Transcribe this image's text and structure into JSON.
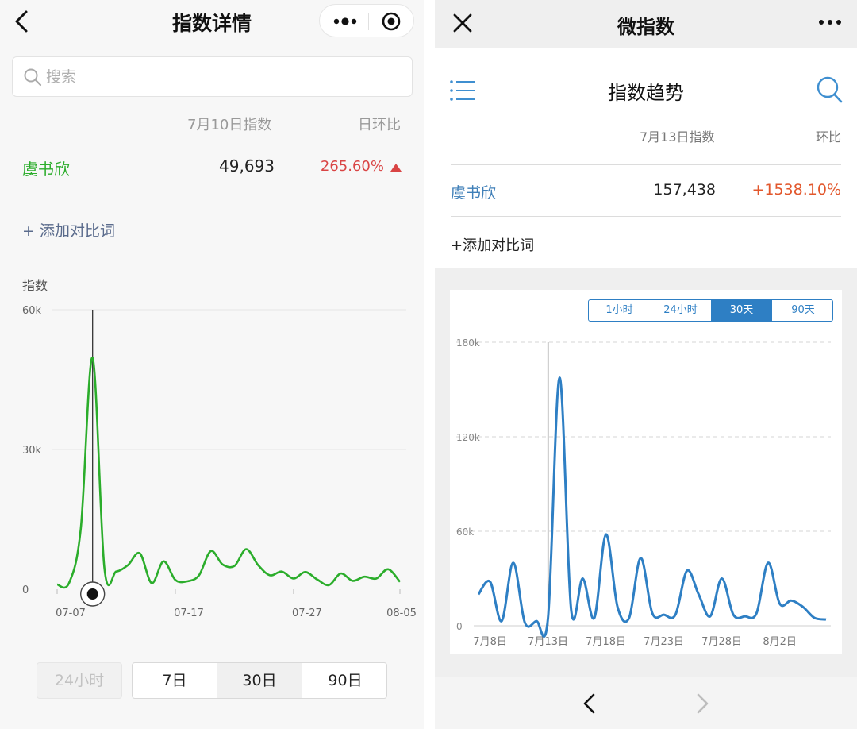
{
  "left": {
    "header": {
      "title": "指数详情"
    },
    "search": {
      "placeholder": "搜索"
    },
    "table": {
      "col_index": "7月10日指数",
      "col_change": "日环比",
      "row": {
        "term": "虞书欣",
        "value": "49,693",
        "change": "265.60%"
      }
    },
    "add_compare": "+ 添加对比词",
    "ranges": [
      "24小时",
      "7日",
      "30日",
      "90日"
    ],
    "colors": {
      "line": "#2bad2b",
      "term": "#2bad2b",
      "up": "#d94444"
    },
    "chart_data": {
      "type": "line",
      "ylabel": "指数",
      "ylim": [
        0,
        60000
      ],
      "yticks": [
        0,
        30000,
        60000
      ],
      "ytick_labels": [
        "0",
        "30k",
        "60k"
      ],
      "xtick_labels": [
        "07-07",
        "07-17",
        "07-27",
        "08-05"
      ],
      "x": [
        "07-07",
        "07-08",
        "07-09",
        "07-10",
        "07-11",
        "07-12",
        "07-13",
        "07-14",
        "07-15",
        "07-16",
        "07-17",
        "07-18",
        "07-19",
        "07-20",
        "07-21",
        "07-22",
        "07-23",
        "07-24",
        "07-25",
        "07-26",
        "07-27",
        "07-28",
        "07-29",
        "07-30",
        "07-31",
        "08-01",
        "08-02",
        "08-03",
        "08-04",
        "08-05"
      ],
      "series": [
        {
          "values": [
            1000,
            1300,
            13000,
            49693,
            4500,
            3800,
            5200,
            7700,
            1300,
            6000,
            2000,
            1700,
            3000,
            8200,
            5300,
            5000,
            8600,
            5200,
            3000,
            3800,
            2300,
            3700,
            2100,
            900,
            3400,
            1800,
            2700,
            2300,
            4300,
            1600
          ]
        }
      ],
      "highlight": "07-10"
    }
  },
  "right": {
    "header": {
      "title": "微指数"
    },
    "subtitle": "指数趋势",
    "table": {
      "col_index": "7月13日指数",
      "col_change": "环比",
      "row": {
        "term": "虞书欣",
        "value": "157,438",
        "change": "+1538.10%"
      }
    },
    "add_compare": "+添加对比词",
    "tabs": [
      "1小时",
      "24小时",
      "30天",
      "90天"
    ],
    "active_tab": "30天",
    "colors": {
      "line": "#2e7fc4",
      "term": "#3f7fb8",
      "up": "#e2572c",
      "accent": "#2e7fc4"
    },
    "chart_data": {
      "type": "line",
      "ylim": [
        0,
        180000
      ],
      "yticks": [
        0,
        60000,
        120000,
        180000
      ],
      "ytick_labels": [
        "0",
        "60k",
        "120k",
        "180k"
      ],
      "xtick_labels": [
        "7月8日",
        "7月13日",
        "7月18日",
        "7月23日",
        "7月28日",
        "8月2日"
      ],
      "x": [
        "7月7日",
        "7月8日",
        "7月9日",
        "7月10日",
        "7月11日",
        "7月12日",
        "7月13日",
        "7月14日",
        "7月15日",
        "7月16日",
        "7月17日",
        "7月18日",
        "7月19日",
        "7月20日",
        "7月21日",
        "7月22日",
        "7月23日",
        "7月24日",
        "7月25日",
        "7月26日",
        "7月27日",
        "7月28日",
        "7月29日",
        "7月30日",
        "7月31日",
        "8月1日",
        "8月2日",
        "8月3日",
        "8月4日",
        "8月5日",
        "8月6日"
      ],
      "series": [
        {
          "values": [
            20000,
            28000,
            3000,
            40000,
            2000,
            3000,
            5000,
            157438,
            10000,
            30000,
            5000,
            58000,
            12000,
            5000,
            43000,
            8000,
            7000,
            7000,
            35000,
            20000,
            6000,
            30000,
            7000,
            6000,
            8000,
            40000,
            14000,
            16000,
            12000,
            5000,
            4000
          ]
        }
      ],
      "highlight": "7月13日"
    }
  }
}
